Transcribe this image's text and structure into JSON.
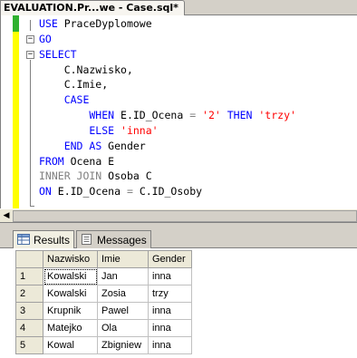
{
  "tab": {
    "title": "EVALUATION.Pr...we - Case.sql*"
  },
  "editor": {
    "lines": [
      [
        {
          "t": "USE ",
          "c": "kw"
        },
        {
          "t": "PraceDyplomowe",
          "c": "txt"
        }
      ],
      [
        {
          "t": "GO",
          "c": "kw"
        }
      ],
      [
        {
          "t": "SELECT",
          "c": "kw"
        }
      ],
      [
        {
          "t": "    C.Nazwisko,",
          "c": "txt"
        }
      ],
      [
        {
          "t": "    C.Imie,",
          "c": "txt"
        }
      ],
      [
        {
          "t": "    CASE",
          "c": "kw"
        }
      ],
      [
        {
          "t": "        WHEN ",
          "c": "kw"
        },
        {
          "t": "E.ID_Ocena ",
          "c": "txt"
        },
        {
          "t": "= ",
          "c": "gr"
        },
        {
          "t": "'2' ",
          "c": "str"
        },
        {
          "t": "THEN ",
          "c": "kw"
        },
        {
          "t": "'trzy'",
          "c": "str"
        }
      ],
      [
        {
          "t": "        ELSE ",
          "c": "kw"
        },
        {
          "t": "'inna'",
          "c": "str"
        }
      ],
      [
        {
          "t": "    END ",
          "c": "kw"
        },
        {
          "t": "AS ",
          "c": "kw"
        },
        {
          "t": "Gender",
          "c": "txt"
        }
      ],
      [
        {
          "t": "FROM ",
          "c": "kw"
        },
        {
          "t": "Ocena E",
          "c": "txt"
        }
      ],
      [
        {
          "t": "INNER JOIN ",
          "c": "gr"
        },
        {
          "t": "Osoba C",
          "c": "txt"
        }
      ],
      [
        {
          "t": "ON ",
          "c": "kw"
        },
        {
          "t": "E.ID_Ocena ",
          "c": "txt"
        },
        {
          "t": "= ",
          "c": "gr"
        },
        {
          "t": "C.ID_Osoby",
          "c": "txt"
        }
      ]
    ]
  },
  "results_tabs": {
    "results": "Results",
    "messages": "Messages"
  },
  "grid": {
    "columns": [
      "Nazwisko",
      "Imie",
      "Gender"
    ],
    "rows": [
      {
        "n": "1",
        "nazwisko": "Kowalski",
        "imie": "Jan",
        "gender": "inna"
      },
      {
        "n": "2",
        "nazwisko": "Kowalski",
        "imie": "Zosia",
        "gender": "trzy"
      },
      {
        "n": "3",
        "nazwisko": "Krupnik",
        "imie": "Pawel",
        "gender": "inna"
      },
      {
        "n": "4",
        "nazwisko": "Matejko",
        "imie": "Ola",
        "gender": "inna"
      },
      {
        "n": "5",
        "nazwisko": "Kowal",
        "imie": "Zbigniew",
        "gender": "inna"
      }
    ]
  },
  "colors": {
    "keyword": "#0000ff",
    "string": "#ff0000",
    "operator": "#808080",
    "change_bar": "#ffff00"
  }
}
